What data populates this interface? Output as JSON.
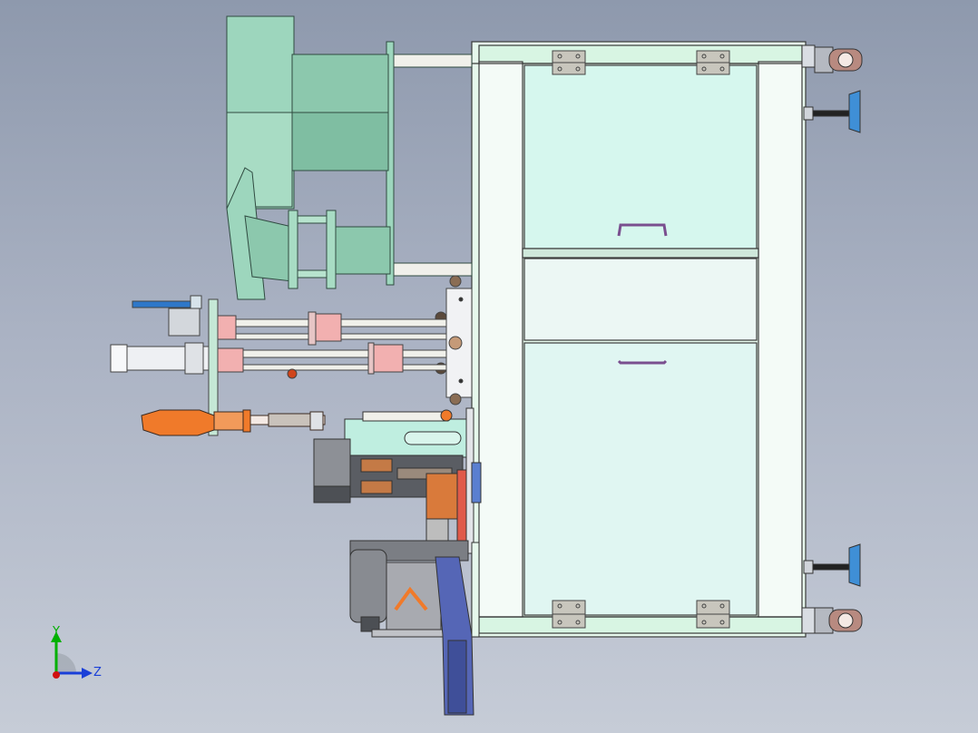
{
  "triad": {
    "y_label": "Y",
    "z_label": "Z"
  },
  "colors": {
    "background_top": "#8e99ad",
    "background_bottom": "#c6ccd7",
    "panel": "#d6f7ee",
    "frame": "#e6f8ec",
    "green_part": "#9dd6bd",
    "green_dark": "#6aa98d",
    "steel": "#e9ebef",
    "rod": "#f0f0ea",
    "bushing_pink": "#f2b0b0",
    "orange_part": "#f07a2a",
    "blue_part": "#5566b6",
    "dark_gray": "#6d6f74",
    "axis_green": "#00b000",
    "axis_blue": "#1a3fd8",
    "axis_red": "#d01010"
  }
}
